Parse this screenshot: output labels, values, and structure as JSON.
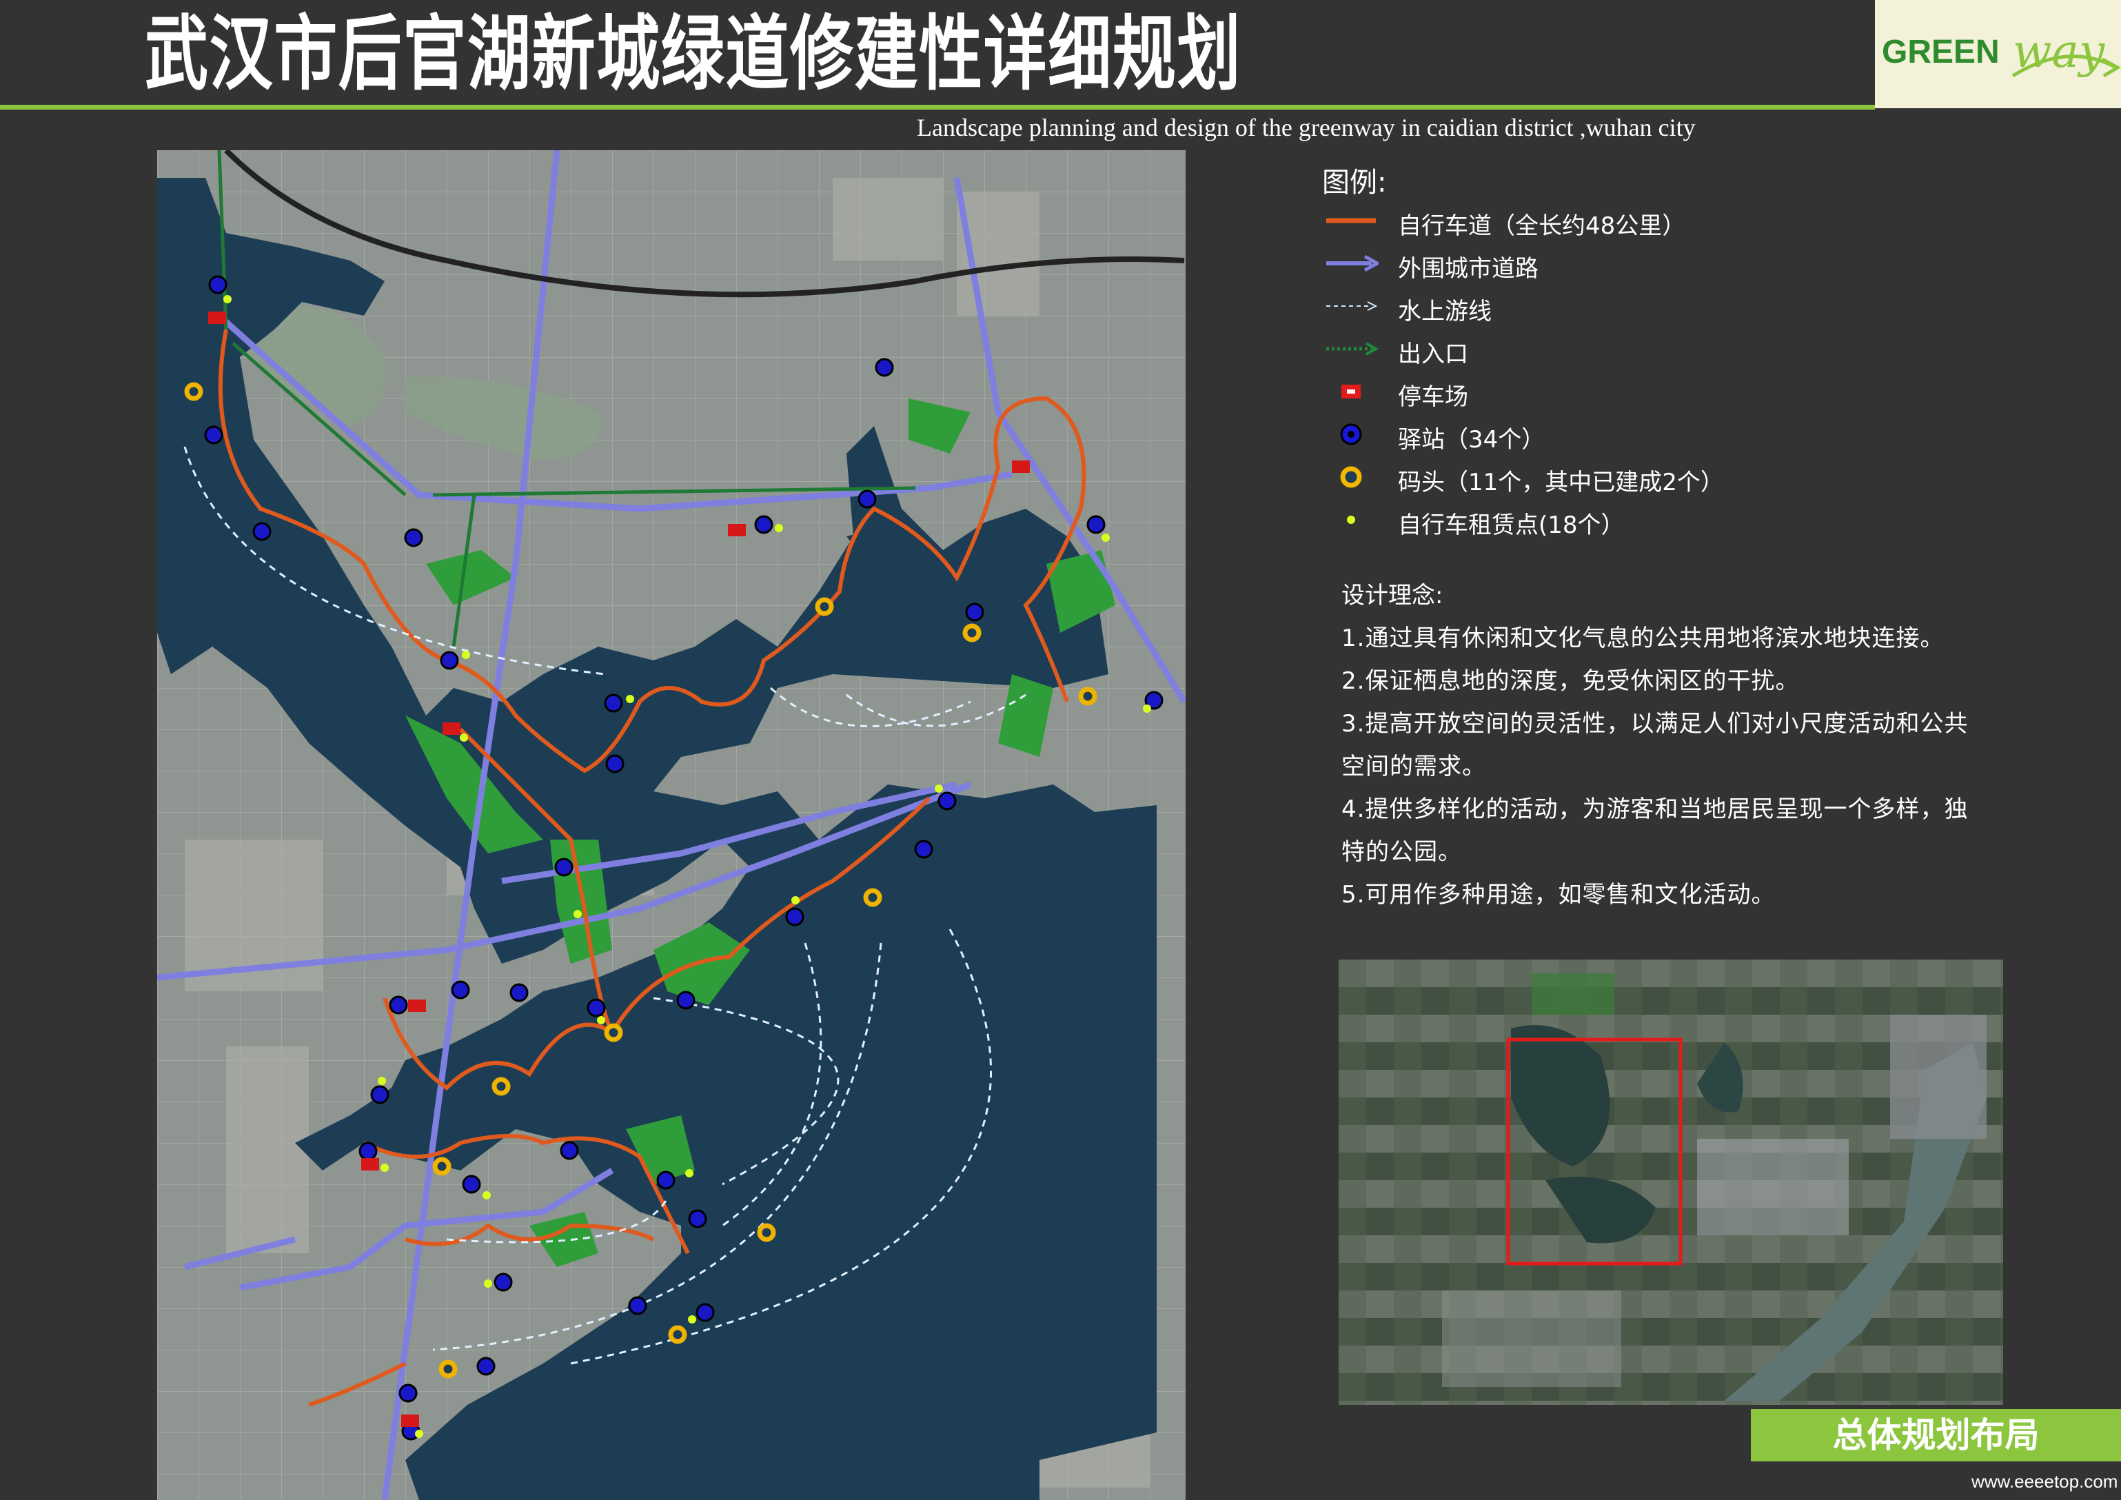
{
  "header": {
    "title": "武汉市后官湖新城绿道修建性详细规划",
    "subtitle": "Landscape planning and design of the greenway in caidian district ,wuhan city"
  },
  "logo": {
    "part1": "GREEN",
    "part2": "way"
  },
  "legend": {
    "heading": "图例:",
    "items": [
      {
        "label": "自行车道（全长约48公里）",
        "icon": "orange-line"
      },
      {
        "label": "外围城市道路",
        "icon": "purple-arrow"
      },
      {
        "label": "水上游线",
        "icon": "dashed-arrow"
      },
      {
        "label": "出入口",
        "icon": "green-dotted-arrow"
      },
      {
        "label": "停车场",
        "icon": "red-parking"
      },
      {
        "label": "驿站（34个）",
        "icon": "blue-station"
      },
      {
        "label": "码头（11个，其中已建成2个）",
        "icon": "yellow-pier"
      },
      {
        "label": "自行车租赁点(18个）",
        "icon": "green-dot"
      }
    ]
  },
  "concept": {
    "heading": "设计理念:",
    "lines": [
      "1.通过具有休闲和文化气息的公共用地将滨水地块连接。",
      "2.保证栖息地的深度，免受休闲区的干扰。",
      "3.提高开放空间的灵活性，以满足人们对小尺度活动和公共",
      "空间的需求。",
      "4.提供多样化的活动，为游客和当地居民呈现一个多样，独",
      "特的公园。",
      "5.可用作多种用途，如零售和文化活动。"
    ]
  },
  "footer": {
    "label": "总体规划布局"
  },
  "watermark": "www.eeeetop.com",
  "colors": {
    "bike_lane": "#e05a1e",
    "city_road": "#7f7fe0",
    "water": "#1d3d55",
    "green_space": "#2f9e3a",
    "accent": "#8cc63f"
  }
}
